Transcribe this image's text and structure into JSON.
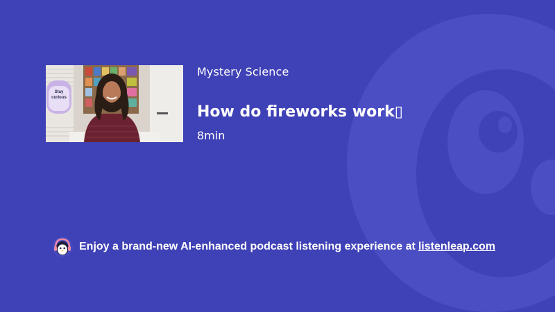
{
  "episode": {
    "channel": "Mystery Science",
    "title": "How do fireworks work▯",
    "duration": "8min",
    "thumbnail": {
      "sign_text_line1": "Stay",
      "sign_text_line2": "curious"
    }
  },
  "promo": {
    "text": "Enjoy a brand-new AI-enhanced podcast listening experience at",
    "link_label": "listenleap.com",
    "logo_icon": "penguin-headphones-icon"
  },
  "colors": {
    "background": "#3f41b6",
    "mascot_watermark": "#5356c6",
    "text": "#ffffff"
  }
}
